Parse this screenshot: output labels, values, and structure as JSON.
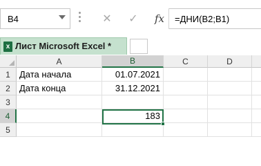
{
  "formula_bar": {
    "name_box": "B4",
    "cancel_glyph": "✕",
    "enter_glyph": "✓",
    "fx_label": "fx",
    "formula": "=ДНИ(B2;B1)"
  },
  "sheet_tab": {
    "icon": "excel-icon",
    "icon_letter": "x",
    "title": "Лист Microsoft Excel *"
  },
  "grid": {
    "columns": [
      "A",
      "B",
      "C",
      "D"
    ],
    "rows": [
      "1",
      "2",
      "3",
      "4",
      "5"
    ],
    "selected_cell": "B4",
    "cells": {
      "A1": "Дата начала",
      "B1": "01.07.2021",
      "A2": "Дата конца",
      "B2": "31.12.2021",
      "B4": "183"
    }
  },
  "colors": {
    "accent": "#217346",
    "tab_background": "#c5e1ce"
  }
}
